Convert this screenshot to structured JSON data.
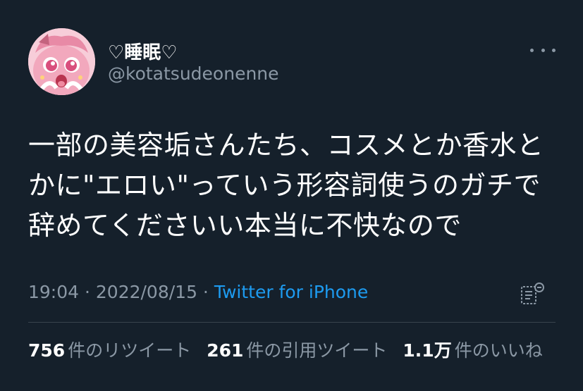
{
  "user": {
    "display_name": "♡睡眠♡",
    "handle": "@kotatsudeonenne"
  },
  "tweet": {
    "text": "一部の美容垢さんたち、コスメとか香水と\nかに\"エロい\"っていう形容詞使うのガチで\n辞めてくださいい本当に不快なので",
    "time": "19:04",
    "sep1": " · ",
    "date": "2022/08/15",
    "sep2": " · ",
    "source": "Twitter for iPhone"
  },
  "stats": {
    "retweets_num": "756",
    "retweets_label": "件のリツイート",
    "quotes_num": "261",
    "quotes_label": "件の引用ツイート",
    "likes_num": "1.1万",
    "likes_label": "件のいいね"
  },
  "icons": {
    "avatar": "anime-character-avatar",
    "more": "more-horizontal-icon",
    "analytics": "analytics-icon"
  },
  "colors": {
    "background": "#15202b",
    "text_primary": "#ffffff",
    "text_secondary": "#8b98a5",
    "link": "#1d9bf0",
    "divider": "#38444d"
  }
}
